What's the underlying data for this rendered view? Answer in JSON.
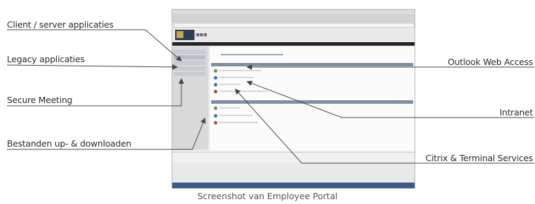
{
  "callouts": {
    "client_server": "Client / server applicaties",
    "legacy": "Legacy applicaties",
    "secure_meeting": "Secure Meeting",
    "files": "Bestanden up- & downloaden",
    "outlook": "Outlook Web Access",
    "intranet": "Intranet",
    "citrix": "Citrix & Terminal Services"
  },
  "caption": "Screenshot van Employee Portal",
  "colors": {
    "leader": "#444444",
    "portal_header": "#7f8fa3",
    "taskbar": "#3c5a8a",
    "brand": "#2d3e55"
  }
}
